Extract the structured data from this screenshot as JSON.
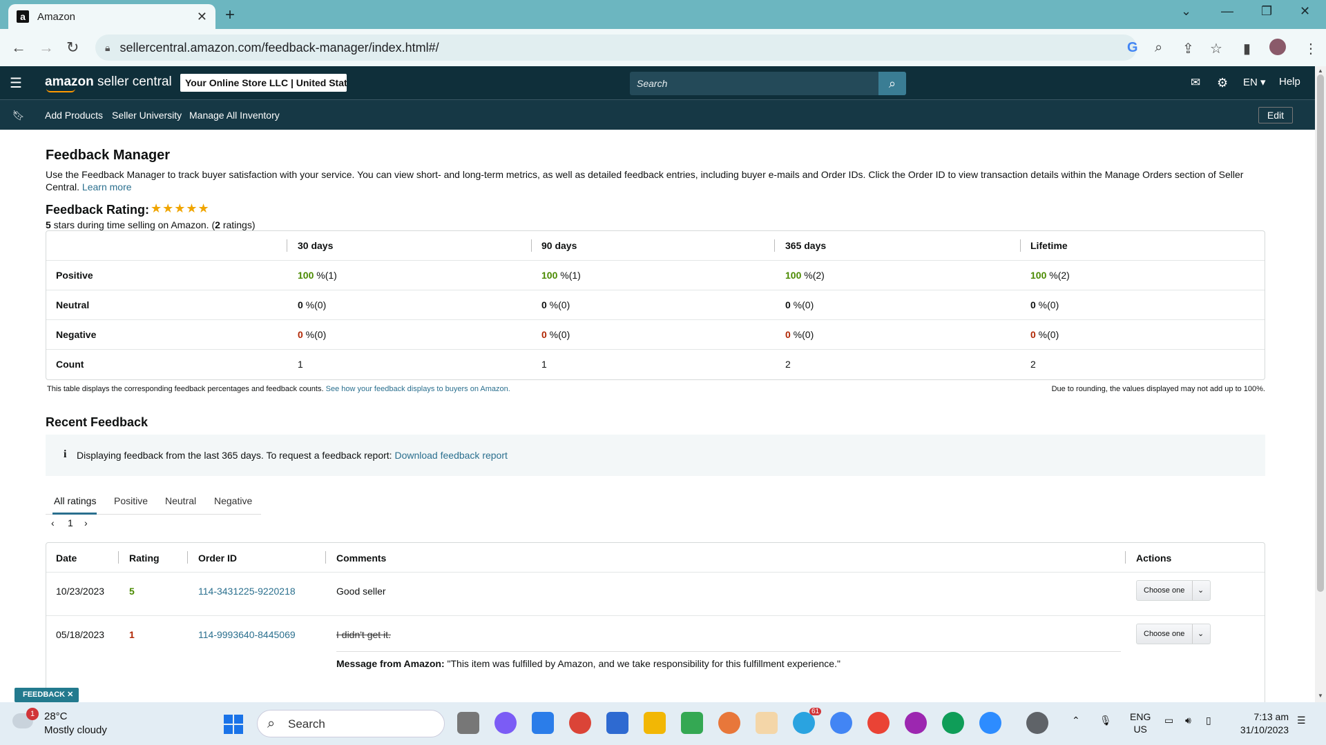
{
  "browser": {
    "tab_title": "Amazon",
    "tab_favicon": "a",
    "url": "sellercentral.amazon.com/feedback-manager/index.html#/"
  },
  "header": {
    "logo_main": "amazon",
    "logo_sub": " seller central",
    "store": "Your Online Store LLC | United States",
    "search_placeholder": "Search",
    "lang": "EN ▾",
    "help": "Help"
  },
  "nav": {
    "links": [
      "Add Products",
      "Seller University",
      "Manage All Inventory"
    ],
    "edit": "Edit"
  },
  "page": {
    "title": "Feedback Manager",
    "description": "Use the Feedback Manager to track buyer satisfaction with your service. You can view short- and long-term metrics, as well as detailed feedback entries, including buyer e-mails and Order IDs. Click the Order ID to view transaction details within the Manage Orders section of Seller Central.",
    "learn_more": "Learn more",
    "rating_title": "Feedback Rating:",
    "stars": "★★★★★",
    "rating_stars_value": 5,
    "rating_sub_a": "5",
    "rating_sub_b": " stars during time selling on Amazon. (",
    "rating_sub_c": "2",
    "rating_sub_d": " ratings)"
  },
  "metrics": {
    "columns": [
      "30 days",
      "90 days",
      "365 days",
      "Lifetime"
    ],
    "rows": [
      {
        "label": "Positive",
        "cells": [
          [
            "100",
            " %(1)"
          ],
          [
            "100",
            " %(1)"
          ],
          [
            "100",
            " %(2)"
          ],
          [
            "100",
            " %(2)"
          ]
        ]
      },
      {
        "label": "Neutral",
        "cells": [
          [
            "0",
            " %(0)"
          ],
          [
            "0",
            " %(0)"
          ],
          [
            "0",
            " %(0)"
          ],
          [
            "0",
            " %(0)"
          ]
        ]
      },
      {
        "label": "Negative",
        "cells": [
          [
            "0",
            " %(0)"
          ],
          [
            "0",
            " %(0)"
          ],
          [
            "0",
            " %(0)"
          ],
          [
            "0",
            " %(0)"
          ]
        ]
      },
      {
        "label": "Count",
        "cells": [
          [
            "",
            "1"
          ],
          [
            "",
            "1"
          ],
          [
            "",
            "2"
          ],
          [
            "",
            "2"
          ]
        ]
      }
    ],
    "note_left": "This table displays the corresponding feedback percentages and feedback counts.",
    "note_link": "See how your feedback displays to buyers on Amazon.",
    "note_right": "Due to rounding, the values displayed may not add up to 100%."
  },
  "recent": {
    "title": "Recent Feedback",
    "info_text": "Displaying feedback from the last 365 days. To request a feedback report:",
    "info_link": "Download feedback report",
    "tabs": [
      "All ratings",
      "Positive",
      "Neutral",
      "Negative"
    ],
    "page": "1",
    "columns": [
      "Date",
      "Rating",
      "Order ID",
      "Comments",
      "Actions"
    ],
    "rows": [
      {
        "date": "10/23/2023",
        "rating": "5",
        "order": "114-3431225-9220218",
        "comment": "Good seller",
        "action": "Choose one"
      },
      {
        "date": "05/18/2023",
        "rating": "1",
        "order": "114-9993640-8445069",
        "comment": "I didn't get it.",
        "action": "Choose one",
        "message_label": "Message from Amazon:",
        "message": " \"This item was fulfilled by Amazon, and we take responsibility for this fulfillment experience.\""
      }
    ]
  },
  "feedback_tag": "FEEDBACK ✕",
  "taskbar": {
    "weather_temp": "28°C",
    "weather_desc": "Mostly cloudy",
    "weather_badge": "1",
    "search": "Search",
    "lang1": "ENG",
    "lang2": "US",
    "time": "7:13 am",
    "date": "31/10/2023",
    "telegram_badge": "61"
  }
}
